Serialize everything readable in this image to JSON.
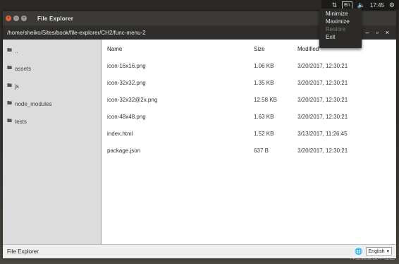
{
  "tray": {
    "clock": "17:45",
    "lang_indicator": "En"
  },
  "window": {
    "title": "File Explorer",
    "path": "/home/sheiko/Sites/book/file-explorer/CH2/func-menu-2",
    "controls": {
      "minimize": "–",
      "maximize": "▫",
      "close": "×"
    }
  },
  "sidebar": {
    "items": [
      {
        "label": ".."
      },
      {
        "label": "assets"
      },
      {
        "label": "js"
      },
      {
        "label": "node_modules"
      },
      {
        "label": "tests"
      }
    ]
  },
  "filelist": {
    "headers": {
      "name": "Name",
      "size": "Size",
      "modified": "Modified"
    },
    "rows": [
      {
        "name": "icon-16x16.png",
        "size": "1.06 KB",
        "modified": "3/20/2017, 12:30:21"
      },
      {
        "name": "icon-32x32.png",
        "size": "1.35 KB",
        "modified": "3/20/2017, 12:30:21"
      },
      {
        "name": "icon-32x32@2x.png",
        "size": "12.58 KB",
        "modified": "3/20/2017, 12:30:21"
      },
      {
        "name": "icon-48x48.png",
        "size": "1.63 KB",
        "modified": "3/20/2017, 12:30:21"
      },
      {
        "name": "index.html",
        "size": "1.52 KB",
        "modified": "3/13/2017, 11:26:45"
      },
      {
        "name": "package.json",
        "size": "637 B",
        "modified": "3/20/2017, 12:30:21"
      }
    ]
  },
  "statusbar": {
    "title": "File Explorer",
    "language": "English"
  },
  "tray_menu": {
    "items": [
      {
        "label": "Minimize"
      },
      {
        "label": "Maximize"
      },
      {
        "label": "Restore"
      },
      {
        "label": "Exit"
      }
    ]
  },
  "watermark": "稀土掘金技术社区"
}
